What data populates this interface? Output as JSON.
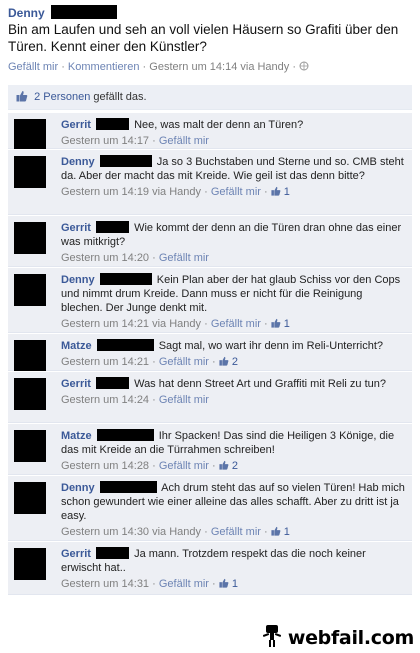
{
  "post": {
    "author": "Denny",
    "text": "Bin am Laufen und seh an voll vielen Häusern so Grafiti über den Türen. Kennt einer den Künstler?",
    "meta_like": "Gefällt mir",
    "meta_comment": "Kommentieren",
    "meta_time": "Gestern um 14:14 via Handy",
    "separator": "·"
  },
  "likes": {
    "count_link": "2 Personen",
    "suffix": "gefällt das."
  },
  "comments": [
    {
      "author": "Gerrit",
      "text": "Nee, was malt der denn an Türen?",
      "time": "Gestern um 14:17",
      "like": "Gefällt mir",
      "count": ""
    },
    {
      "author": "Denny",
      "text": "Ja so 3 Buchstaben und Sterne und so. CMB steht da. Aber der macht das mit Kreide. Wie geil ist das denn bitte?",
      "time": "Gestern um 14:19 via Handy",
      "like": "Gefällt mir",
      "count": "1"
    },
    {
      "author": "Gerrit",
      "text": "Wie kommt der denn an die Türen dran ohne das einer was mitkrigt?",
      "time": "Gestern um 14:20",
      "like": "Gefällt mir",
      "count": ""
    },
    {
      "author": "Denny",
      "text": "Kein Plan aber der hat glaub Schiss vor den Cops und nimmt drum Kreide. Dann muss er nicht für die Reinigung blechen. Der Junge denkt mit.",
      "time": "Gestern um 14:21 via Handy",
      "like": "Gefällt mir",
      "count": "1"
    },
    {
      "author": "Matze",
      "text": "Sagt mal, wo wart ihr denn im Reli-Unterricht?",
      "time": "Gestern um 14:21",
      "like": "Gefällt mir",
      "count": "2"
    },
    {
      "author": "Gerrit",
      "text": "Was hat denn Street Art und Graffiti mit Reli zu tun?",
      "time": "Gestern um 14:24",
      "like": "Gefällt mir",
      "count": ""
    },
    {
      "author": "Matze",
      "text": "Ihr Spacken! Das sind die Heiligen 3 Könige, die das mit Kreide an die Türrahmen schreiben!",
      "time": "Gestern um 14:28",
      "like": "Gefällt mir",
      "count": "2"
    },
    {
      "author": "Denny",
      "text": "Ach drum steht das auf so vielen Türen! Hab mich schon gewundert wie einer alleine das alles schafft. Aber zu dritt ist ja easy.",
      "time": "Gestern um 14:30 via Handy",
      "like": "Gefällt mir",
      "count": "1"
    },
    {
      "author": "Gerrit",
      "text": "Ja mann. Trotzdem respekt das die noch keiner erwischt hat..",
      "time": "Gestern um 14:31",
      "like": "Gefällt mir",
      "count": "1"
    }
  ],
  "watermark": {
    "logo_text": "webfail.com"
  },
  "colors": {
    "link": "#3b5998",
    "comment_bg": "#edeff4",
    "meta": "#808080"
  }
}
